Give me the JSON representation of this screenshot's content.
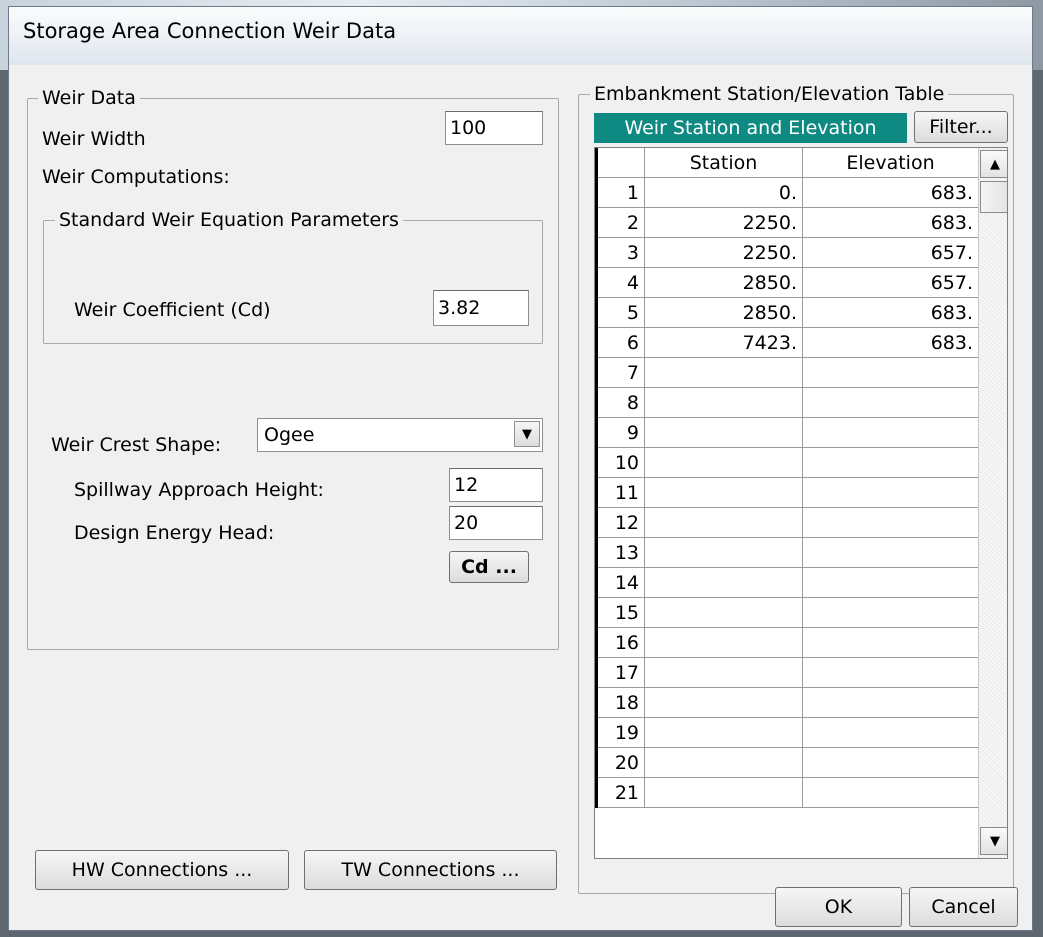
{
  "dialog": {
    "title": "Storage Area Connection Weir Data",
    "ok_label": "OK",
    "cancel_label": "Cancel"
  },
  "weir_data": {
    "group_label": "Weir Data",
    "width_label": "Weir Width",
    "width_value": "100",
    "computations_label": "Weir Computations:",
    "standard_group_label": "Standard Weir Equation Parameters",
    "coefficient_label": "Weir Coefficient (Cd)",
    "coefficient_value": "3.82",
    "crest_shape_label": "Weir Crest Shape:",
    "crest_shape_value": "Ogee",
    "approach_height_label": "Spillway Approach Height:",
    "approach_height_value": "12",
    "design_head_label": "Design Energy Head:",
    "design_head_value": "20",
    "cd_button_label": "Cd ..."
  },
  "connections": {
    "hw_label": "HW Connections ...",
    "tw_label": "TW Connections ..."
  },
  "embankment": {
    "group_label": "Embankment Station/Elevation Table",
    "table_caption": "Weir Station and Elevation",
    "filter_label": "Filter...",
    "columns": [
      "Station",
      "Elevation"
    ],
    "rows": [
      {
        "row": "1",
        "station": "0.",
        "elevation": "683."
      },
      {
        "row": "2",
        "station": "2250.",
        "elevation": "683."
      },
      {
        "row": "3",
        "station": "2250.",
        "elevation": "657."
      },
      {
        "row": "4",
        "station": "2850.",
        "elevation": "657."
      },
      {
        "row": "5",
        "station": "2850.",
        "elevation": "683."
      },
      {
        "row": "6",
        "station": "7423.",
        "elevation": "683."
      },
      {
        "row": "7",
        "station": "",
        "elevation": ""
      },
      {
        "row": "8",
        "station": "",
        "elevation": ""
      },
      {
        "row": "9",
        "station": "",
        "elevation": ""
      },
      {
        "row": "10",
        "station": "",
        "elevation": ""
      },
      {
        "row": "11",
        "station": "",
        "elevation": ""
      },
      {
        "row": "12",
        "station": "",
        "elevation": ""
      },
      {
        "row": "13",
        "station": "",
        "elevation": ""
      },
      {
        "row": "14",
        "station": "",
        "elevation": ""
      },
      {
        "row": "15",
        "station": "",
        "elevation": ""
      },
      {
        "row": "16",
        "station": "",
        "elevation": ""
      },
      {
        "row": "17",
        "station": "",
        "elevation": ""
      },
      {
        "row": "18",
        "station": "",
        "elevation": ""
      },
      {
        "row": "19",
        "station": "",
        "elevation": ""
      },
      {
        "row": "20",
        "station": "",
        "elevation": ""
      },
      {
        "row": "21",
        "station": "",
        "elevation": ""
      }
    ]
  },
  "colors": {
    "caption_bg": "#0e8a82",
    "caption_text": "#ffffff"
  },
  "icons": {
    "scroll_up": "▲",
    "scroll_down": "▼",
    "combo_arrow": "▼"
  }
}
